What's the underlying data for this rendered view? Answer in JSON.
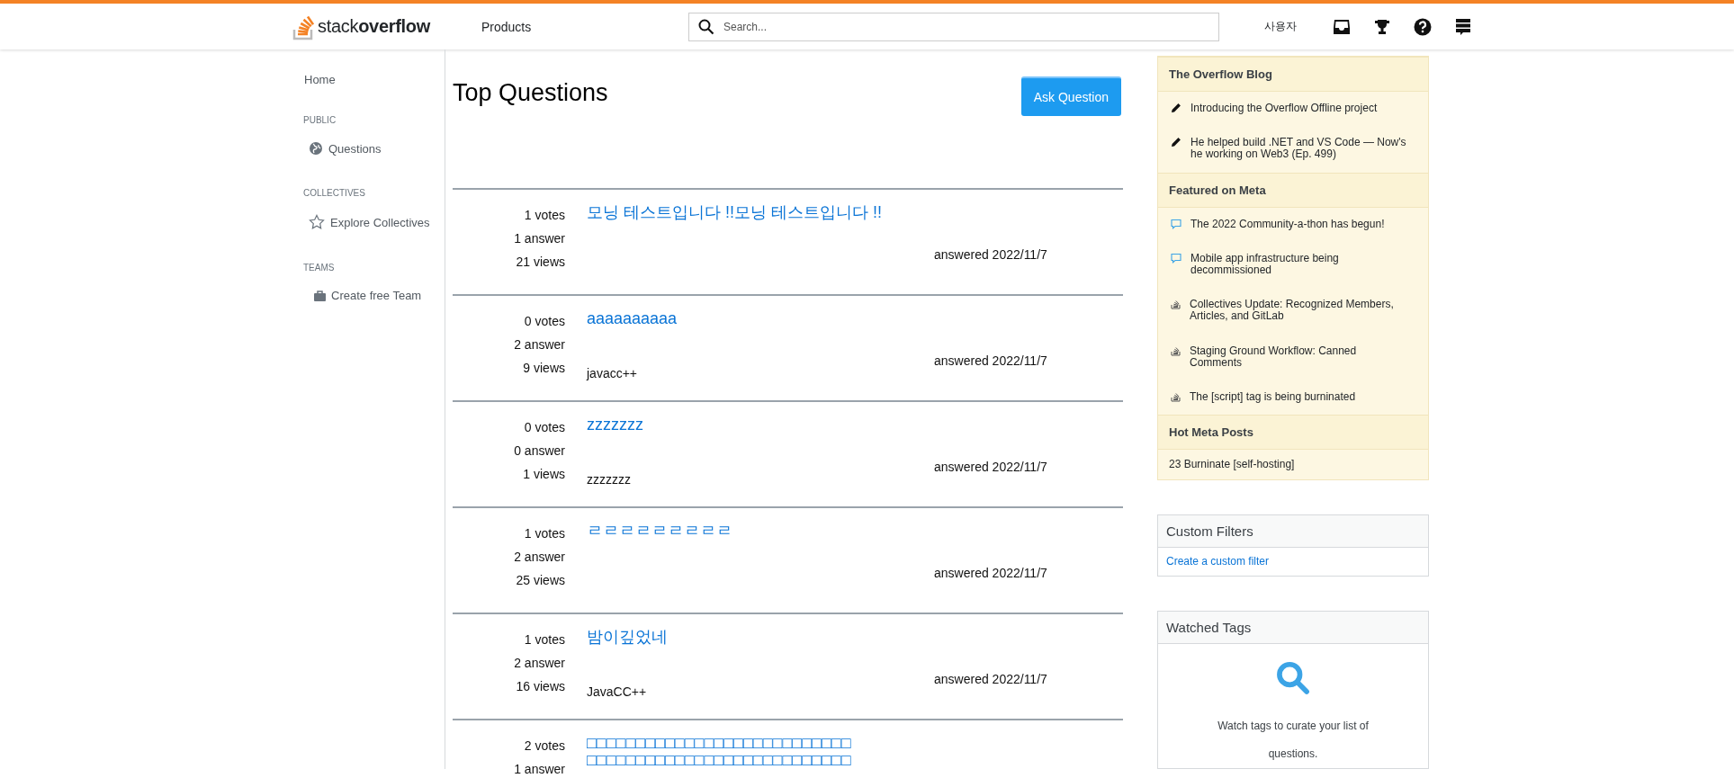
{
  "header": {
    "logo": "stack**overflow**",
    "products": "Products",
    "search": {
      "placeholder": "Search..."
    },
    "user": "사용자"
  },
  "sidebar": {
    "home": "Home",
    "sections": [
      {
        "heading": "PUBLIC",
        "items": [
          {
            "label": "Questions",
            "kind": "globe"
          }
        ]
      },
      {
        "heading": "COLLECTIVES",
        "items": [
          {
            "label": "Explore Collectives",
            "kind": "star"
          }
        ]
      },
      {
        "heading": "TEAMS",
        "items": [
          {
            "label": "Create free Team",
            "kind": "briefcase"
          }
        ]
      }
    ]
  },
  "main": {
    "title": "Top Questions",
    "ask_button": "Ask Question",
    "questions": [
      {
        "votes": "1 votes",
        "answers": "1 answer",
        "views": "21 views",
        "title": "모닝 테스트입니다 !!모닝 테스트입니다 !!",
        "answered": "answered 2022/11/7"
      },
      {
        "votes": "0 votes",
        "answers": "2 answer",
        "views": "9 views",
        "title": "aaaaaaaaaa",
        "tag": "javacc++",
        "answered": "answered 2022/11/7"
      },
      {
        "votes": "0 votes",
        "answers": "0 answer",
        "views": "1 views",
        "title": "zzzzzzz",
        "tag": "zzzzzzz",
        "answered": "answered 2022/11/7"
      },
      {
        "votes": "1 votes",
        "answers": "2 answer",
        "views": "25 views",
        "title": "ㄹㄹㄹㄹㄹㄹㄹㄹㄹ",
        "answered": "answered 2022/11/7"
      },
      {
        "votes": "1 votes",
        "answers": "2 answer",
        "views": "16 views",
        "title": "밤이깊었네",
        "tag": "JavaCC++",
        "answered": "answered 2022/11/7"
      },
      {
        "votes": "2 votes",
        "answers": "1 answer",
        "title": "□□□□□□□□□□□□□□□□□□□□□□□□□□□ □□□□□□□□□□□□□□□□□□□□□□□□□□□"
      }
    ]
  },
  "right": {
    "sections": [
      {
        "heading": "The Overflow Blog",
        "items": [
          {
            "kind": "pencil",
            "text": "Introducing the Overflow Offline project"
          },
          {
            "kind": "pencil",
            "text": "He helped build .NET and VS Code — Now's he working on Web3 (Ep. 499)"
          }
        ]
      },
      {
        "heading": "Featured on Meta",
        "items": [
          {
            "kind": "chat",
            "text": "The 2022 Community-a-thon has begun!"
          },
          {
            "kind": "chat",
            "text": "Mobile app infrastructure being decommissioned"
          },
          {
            "kind": "stack",
            "text": "Collectives Update: Recognized Members, Articles, and GitLab"
          },
          {
            "kind": "stack",
            "text": "Staging Ground Workflow: Canned Comments"
          },
          {
            "kind": "stack",
            "text": "The [script] tag is being burninated"
          }
        ]
      },
      {
        "heading": "Hot Meta Posts",
        "items": [
          {
            "kind": "plain",
            "text": "23 Burninate [self-hosting]"
          }
        ]
      }
    ],
    "custom_filters": {
      "heading": "Custom Filters",
      "link": "Create a custom filter"
    },
    "watched_tags": {
      "heading": "Watched Tags",
      "text": "Watch tags to curate your list of questions."
    }
  }
}
